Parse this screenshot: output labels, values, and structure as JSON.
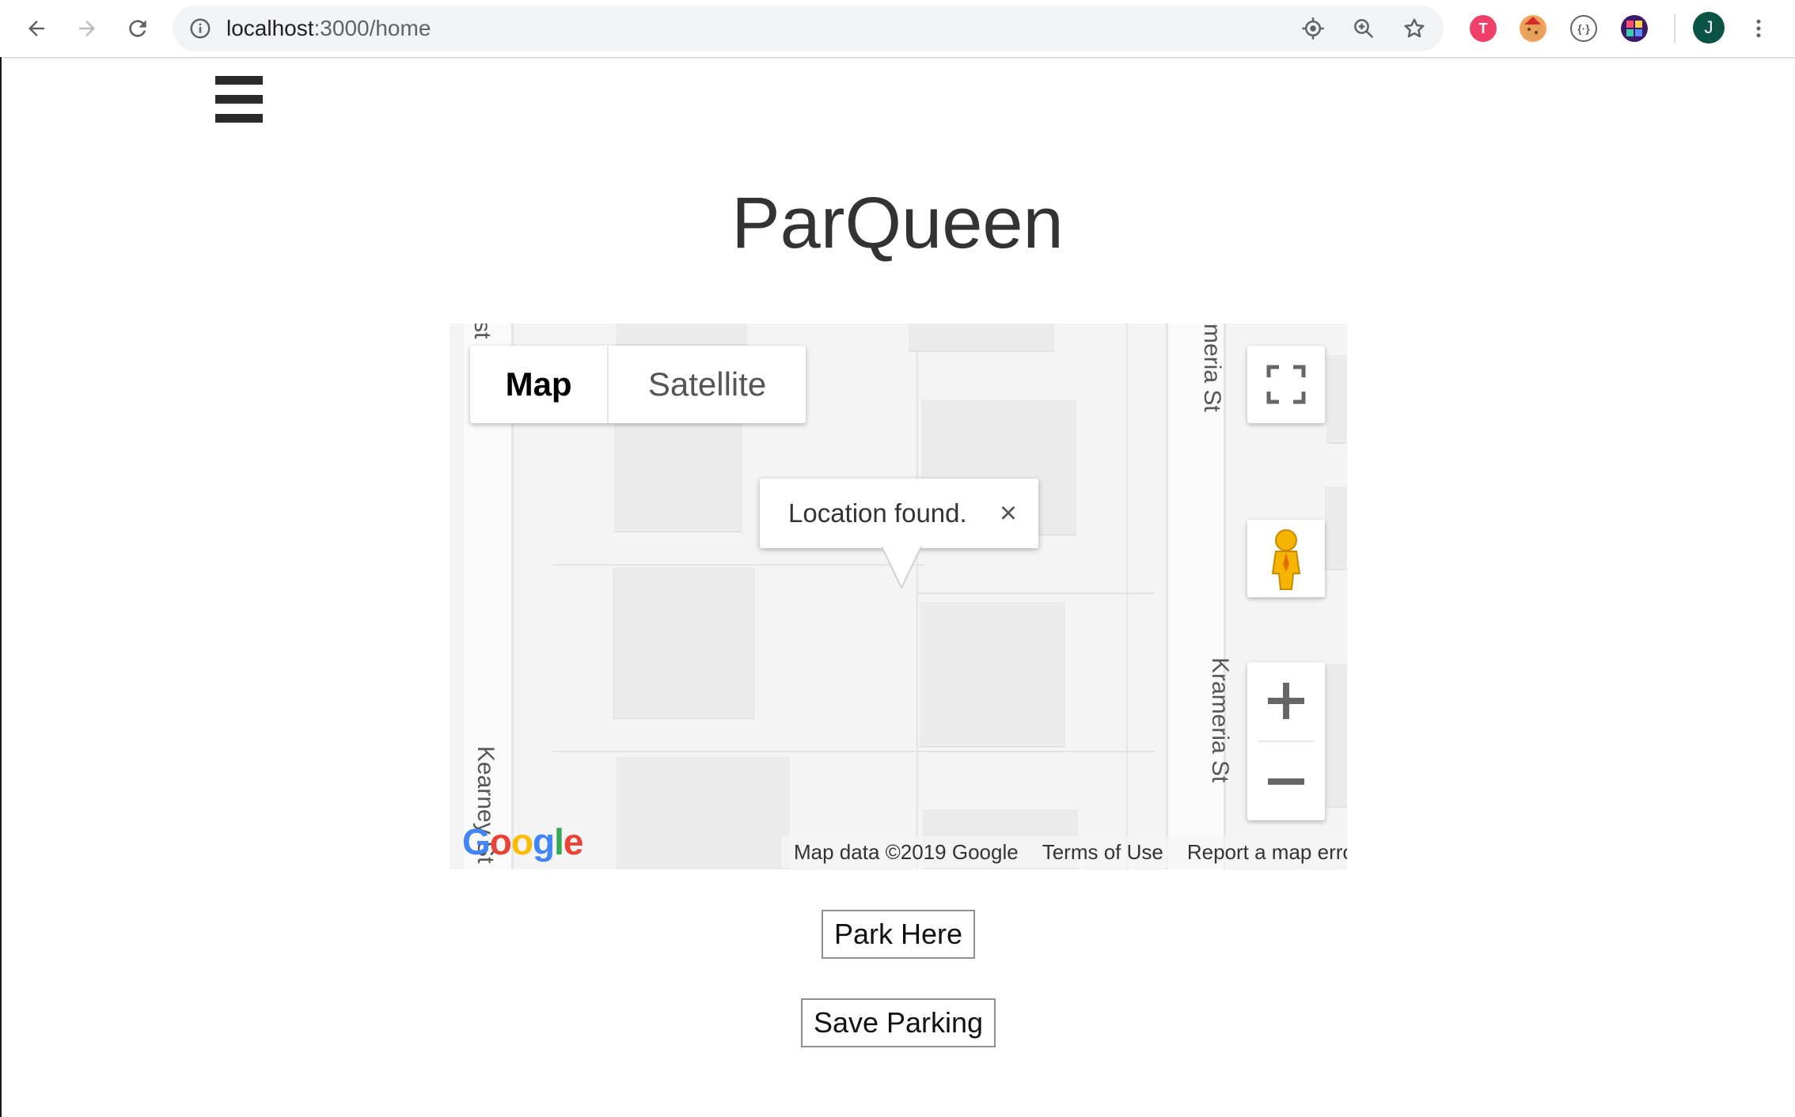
{
  "browser": {
    "url_host": "localhost",
    "url_path": ":3000/home",
    "profile_initial": "J",
    "icons": [
      "back-icon",
      "forward-icon",
      "reload-icon",
      "info-icon",
      "location-icon",
      "zoom-icon",
      "star-icon",
      "menu-dots-icon"
    ]
  },
  "app": {
    "title": "ParQueen",
    "menu_icon": "hamburger-icon"
  },
  "map": {
    "type_control": {
      "map_label": "Map",
      "satellite_label": "Satellite",
      "selected": "Map"
    },
    "info_window": {
      "text": "Location found.",
      "close_symbol": "×"
    },
    "streets": [
      "st",
      "meria St",
      "Krameria St",
      "Kearney St"
    ],
    "logo_letters": [
      "G",
      "o",
      "o",
      "g",
      "l",
      "e"
    ],
    "attribution": {
      "map_data": "Map data ©2019 Google",
      "terms": "Terms of Use",
      "report": "Report a map error"
    },
    "colors": {
      "background": "#f4f4f4",
      "block": "#ebebeb"
    }
  },
  "actions": {
    "park_label": "Park Here",
    "save_label": "Save Parking"
  }
}
